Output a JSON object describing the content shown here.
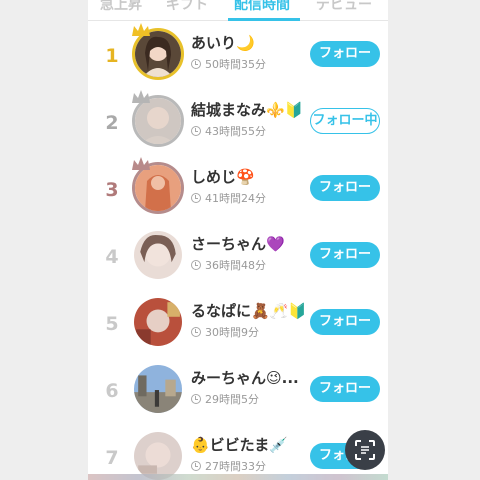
{
  "tabs": [
    {
      "label": "急上昇",
      "active": false
    },
    {
      "label": "ギフト",
      "active": false
    },
    {
      "label": "配信時間",
      "active": true
    },
    {
      "label": "デビュー",
      "active": false
    }
  ],
  "colors": {
    "accent": "#36c2e8",
    "gold": "#e6b422",
    "silver": "#a9a9a9",
    "bronze": "#b07a7a"
  },
  "ranking": [
    {
      "rank": "1",
      "name": "あいり🌙",
      "time": "50時間35分",
      "button": "フォロー",
      "following": false
    },
    {
      "rank": "2",
      "name": "結城まなみ⚜️🔰",
      "time": "43時間55分",
      "button": "フォロー中",
      "following": true
    },
    {
      "rank": "3",
      "name": "しめじ🍄",
      "time": "41時間24分",
      "button": "フォロー",
      "following": false
    },
    {
      "rank": "4",
      "name": "さーちゃん💜",
      "time": "36時間48分",
      "button": "フォロー",
      "following": false
    },
    {
      "rank": "5",
      "name": "るなぱに🧸🥂🔰",
      "time": "30時間9分",
      "button": "フォロー",
      "following": false
    },
    {
      "rank": "6",
      "name": "みーちゃん😉...",
      "time": "29時間5分",
      "button": "フォロー",
      "following": false
    },
    {
      "rank": "7",
      "name": "👶ビビたま💉",
      "time": "27時間33分",
      "button": "フォロー",
      "following": false
    }
  ],
  "icons": {
    "time": "clock-icon",
    "top_rank": "crown-icon",
    "floating_action": "scan-icon"
  }
}
